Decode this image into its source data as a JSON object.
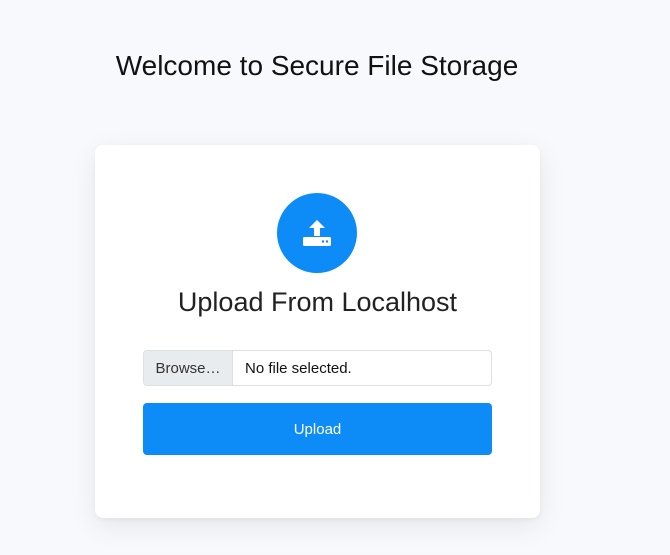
{
  "page": {
    "title": "Welcome to Secure File Storage"
  },
  "card": {
    "icon": "upload-icon",
    "title": "Upload From Localhost",
    "file_input": {
      "browse_label": "Browse…",
      "status_text": "No file selected."
    },
    "upload_label": "Upload"
  },
  "colors": {
    "accent": "#0d8bf7",
    "background": "#f8f9fd",
    "card": "#ffffff"
  }
}
